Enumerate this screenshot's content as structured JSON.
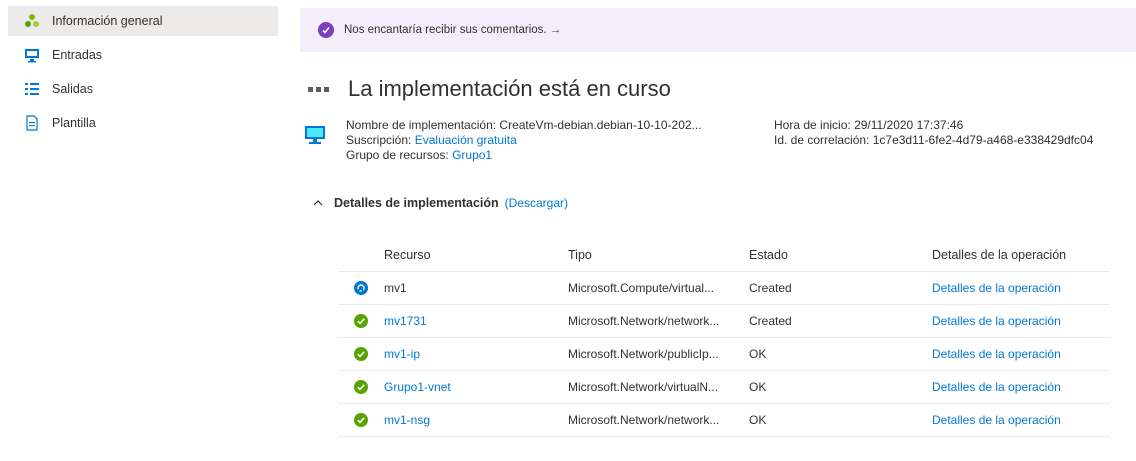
{
  "sidebar": {
    "items": [
      {
        "label": "Información general",
        "icon": "overview-icon"
      },
      {
        "label": "Entradas",
        "icon": "inputs-icon"
      },
      {
        "label": "Salidas",
        "icon": "outputs-icon"
      },
      {
        "label": "Plantilla",
        "icon": "template-icon"
      }
    ]
  },
  "feedback": {
    "text": "Nos encantaría recibir sus comentarios. →",
    "icon": "heart-icon"
  },
  "header": {
    "title": "La implementación está en curso"
  },
  "info": {
    "deployment_name_label": "Nombre de implementación:",
    "deployment_name_value": "CreateVm-debian.debian-10-10-202...",
    "subscription_label": "Suscripción:",
    "subscription_value": "Evaluación gratuita",
    "resource_group_label": "Grupo de recursos:",
    "resource_group_value": "Grupo1",
    "start_time_label": "Hora de inicio:",
    "start_time_value": "29/11/2020 17:37:46",
    "correlation_label": "Id. de correlación:",
    "correlation_value": "1c7e3d11-6fe2-4d79-a468-e338429dfc04"
  },
  "details": {
    "title": "Detalles de implementación",
    "download_label": "(Descargar)"
  },
  "table": {
    "headers": [
      "Recurso",
      "Tipo",
      "Estado",
      "Detalles de la operación"
    ],
    "rows": [
      {
        "status_icon": "in-progress-icon",
        "resource": "mv1",
        "resource_is_link": false,
        "type": "Microsoft.Compute/virtual...",
        "state": "Created",
        "details": "Detalles de la operación"
      },
      {
        "status_icon": "success-icon",
        "resource": "mv1731",
        "resource_is_link": true,
        "type": "Microsoft.Network/network...",
        "state": "Created",
        "details": "Detalles de la operación"
      },
      {
        "status_icon": "success-icon",
        "resource": "mv1-ip",
        "resource_is_link": true,
        "type": "Microsoft.Network/publicIp...",
        "state": "OK",
        "details": "Detalles de la operación"
      },
      {
        "status_icon": "success-icon",
        "resource": "Grupo1-vnet",
        "resource_is_link": true,
        "type": "Microsoft.Network/virtualN...",
        "state": "OK",
        "details": "Detalles de la operación"
      },
      {
        "status_icon": "success-icon",
        "resource": "mv1-nsg",
        "resource_is_link": true,
        "type": "Microsoft.Network/network...",
        "state": "OK",
        "details": "Detalles de la operación"
      }
    ]
  },
  "colors": {
    "link": "#0078d4",
    "success": "#57a300",
    "in_progress": "#0078d4",
    "feedback_bg": "#f3eef9",
    "active_nav": "#edebe9"
  }
}
